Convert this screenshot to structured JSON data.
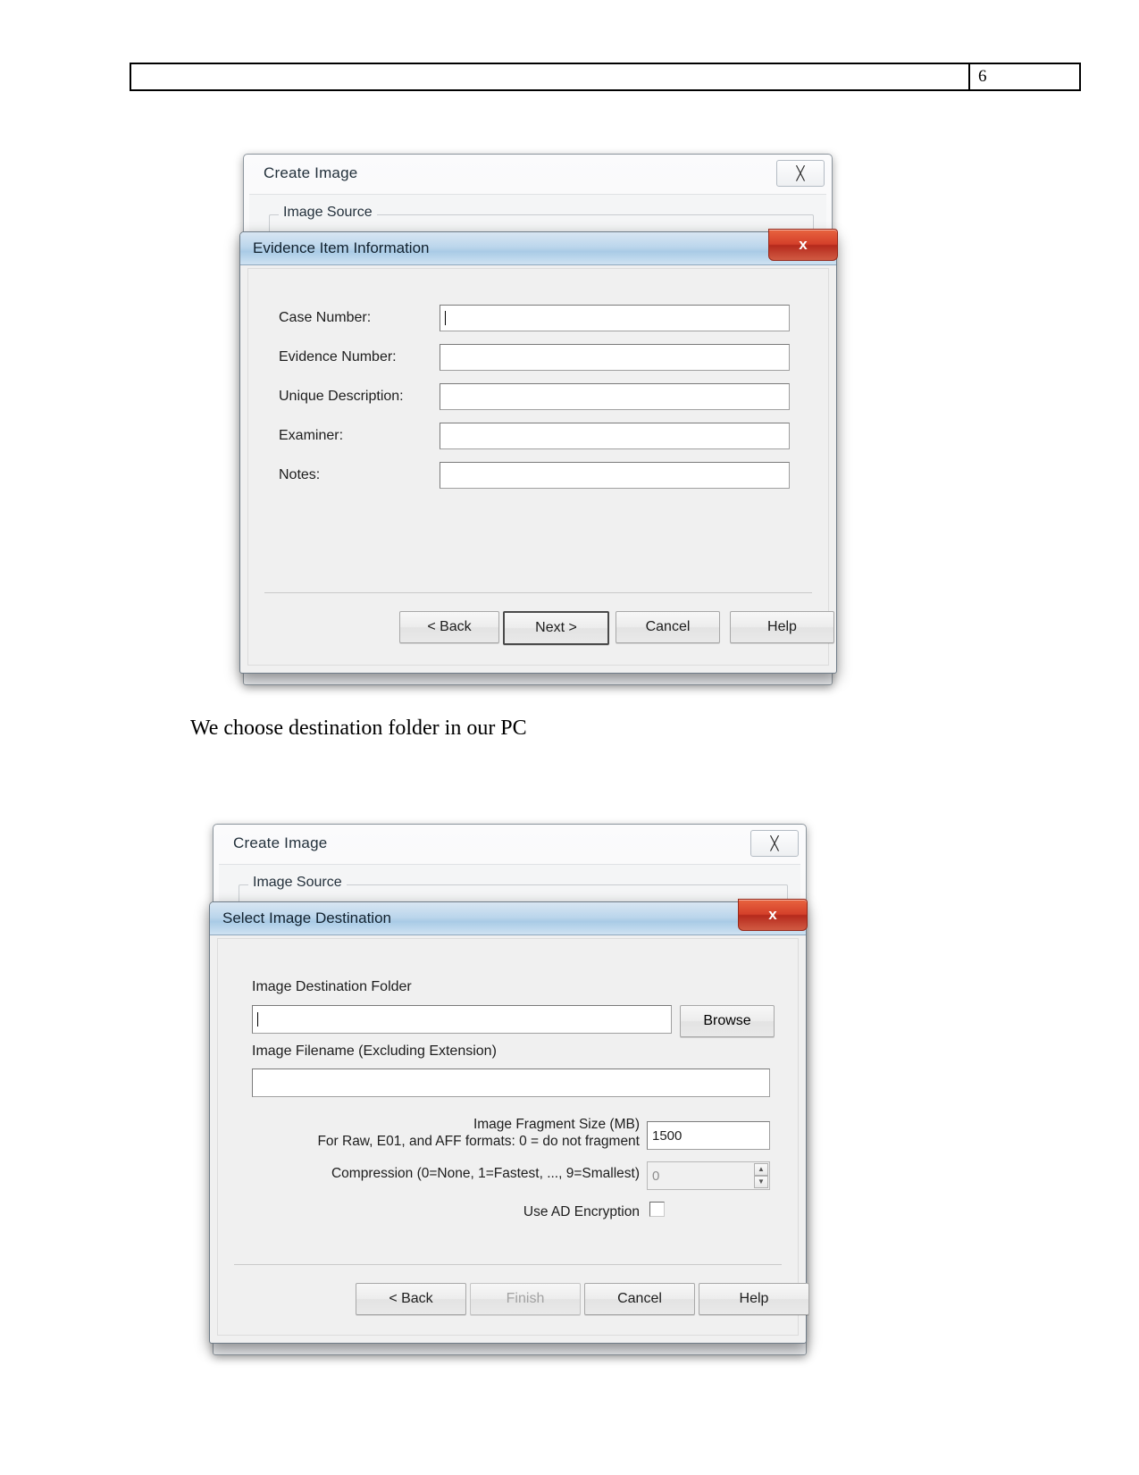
{
  "header": {
    "page_number": "6"
  },
  "caption": "We choose destination folder in our PC",
  "dialog1": {
    "back_window": {
      "title": "Create Image",
      "close_glyph": "╳",
      "group_legend": "Image Source"
    },
    "title": "Evidence Item Information",
    "close_label": "x",
    "fields": [
      {
        "label": "Case Number:",
        "value": ""
      },
      {
        "label": "Evidence Number:",
        "value": ""
      },
      {
        "label": "Unique Description:",
        "value": ""
      },
      {
        "label": "Examiner:",
        "value": ""
      },
      {
        "label": "Notes:",
        "value": ""
      }
    ],
    "buttons": {
      "back": "< Back",
      "next": "Next >",
      "cancel": "Cancel",
      "help": "Help"
    }
  },
  "dialog2": {
    "back_window": {
      "title": "Create Image",
      "close_glyph": "╳",
      "group_legend": "Image Source"
    },
    "title": "Select Image Destination",
    "close_label": "x",
    "destination_folder_label": "Image Destination Folder",
    "destination_folder_value": "",
    "browse_label": "Browse",
    "filename_label": "Image Filename (Excluding Extension)",
    "filename_value": "",
    "fragment_label_line1": "Image Fragment Size (MB)",
    "fragment_label_line2": "For Raw, E01, and AFF formats: 0 = do not fragment",
    "fragment_value": "1500",
    "compression_label": "Compression (0=None, 1=Fastest, ..., 9=Smallest)",
    "compression_value": "0",
    "encryption_label": "Use AD Encryption",
    "encryption_checked": false,
    "buttons": {
      "back": "< Back",
      "finish": "Finish",
      "cancel": "Cancel",
      "help": "Help"
    }
  }
}
